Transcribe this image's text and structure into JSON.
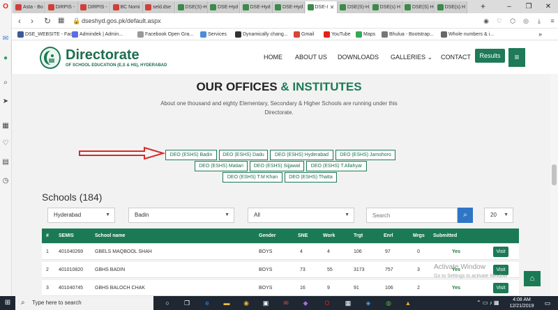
{
  "browser": {
    "tabs": [
      {
        "label": "Asta - Bo",
        "color": "#d0403a"
      },
      {
        "label": "DIRPIS - ",
        "color": "#d0403a"
      },
      {
        "label": "DIRPIS - ",
        "color": "#d0403a"
      },
      {
        "label": "BC Nomi",
        "color": "#d0403a"
      },
      {
        "label": "seld.dse",
        "color": "#d0403a"
      },
      {
        "label": "DSE(S)-H",
        "color": "#3c8a4c"
      },
      {
        "label": "DSE-Hyd",
        "color": "#3c8a4c"
      },
      {
        "label": "DSE-Hyd",
        "color": "#3c8a4c"
      },
      {
        "label": "DSE-Hyd",
        "color": "#3c8a4c"
      },
      {
        "label": "DSE-I",
        "color": "#3c8a4c",
        "active": true
      },
      {
        "label": "DSE(S)-H",
        "color": "#3c8a4c"
      },
      {
        "label": "DSE(s) H",
        "color": "#3c8a4c"
      },
      {
        "label": "DSE(S) H",
        "color": "#3c8a4c"
      },
      {
        "label": "DSE(s) H",
        "color": "#3c8a4c"
      }
    ],
    "new_tab": "+",
    "url": "dseshyd.gos.pk/default.aspx",
    "bookmarks": [
      {
        "label": "DSE_WEBSITE - Fac...",
        "color": "#3b5998"
      },
      {
        "label": "Admindek | Admin...",
        "color": "#5b6ee1"
      },
      {
        "label": "Facebook Open Gra...",
        "color": "#999999"
      },
      {
        "label": "Services",
        "color": "#4e8cd9"
      },
      {
        "label": "Dynamically chang...",
        "color": "#333333"
      },
      {
        "label": "Gmail",
        "color": "#d44638"
      },
      {
        "label": "YouTube",
        "color": "#e62117"
      },
      {
        "label": "Maps",
        "color": "#34a853"
      },
      {
        "label": "Bhulua - Bootstrap...",
        "color": "#777777"
      },
      {
        "label": "Whole numbers & i...",
        "color": "#666666"
      }
    ],
    "bookmarks_more": "»"
  },
  "site": {
    "brand_title": "Directorate",
    "brand_subtitle": "OF SCHOOL EDUCATION (E,S & HS), HYDERABAD",
    "nav": [
      "HOME",
      "ABOUT US",
      "DOWNLOADS",
      "GALLERIES ⌄",
      "CONTACT"
    ],
    "results_label": "Results",
    "menu_icon": "≡",
    "accent_color": "#1b7a56"
  },
  "offices": {
    "heading_main": "OUR OFFICES",
    "heading_accent": "& INSTITUTES",
    "intro": "About one thousand and eighty Elementary, Secondary & Higher Schools are running under this Directorate.",
    "deo_buttons": [
      "DEO (ESHS) Badin",
      "DEO (ESHS) Dadu",
      "DEO (ESHS) Hyderabad",
      "DEO (ESHS) Jamshoro",
      "DEO (ESHS) Matiari",
      "DEO (ESHS) Sijjawal",
      "DEO (ESHS) T.Allahyar",
      "DEO (ESHS) T.M Khan",
      "DEO (ESHS) Thatta"
    ]
  },
  "schools": {
    "title": "Schools",
    "count": "(184)",
    "filters": {
      "district": "Hyderabad",
      "taluka": "Badin",
      "type": "All",
      "page_size": "20"
    },
    "search_placeholder": "Search",
    "columns": [
      "#",
      "SEMIS",
      "School name",
      "Gender",
      "SNE",
      "Work",
      "Trgt",
      "Enrl",
      "Mrgs",
      "Submitted"
    ],
    "rows": [
      {
        "n": "1",
        "semis": "401040269",
        "name": "GBELS MAQBOOL SHAH",
        "gender": "BOYS",
        "sne": "4",
        "work": "4",
        "trgt": "106",
        "enrl": "97",
        "mrgs": "0",
        "submitted": "Yes"
      },
      {
        "n": "2",
        "semis": "401010820",
        "name": "GBHS BADIN",
        "gender": "BOYS",
        "sne": "73",
        "work": "55",
        "trgt": "3173",
        "enrl": "757",
        "mrgs": "3",
        "submitted": "Yes"
      },
      {
        "n": "3",
        "semis": "401040745",
        "name": "GBHS BALOCH CHAK",
        "gender": "BOYS",
        "sne": "16",
        "work": "9",
        "trgt": "91",
        "enrl": "106",
        "mrgs": "2",
        "submitted": "Yes"
      }
    ],
    "visit_label": "Visit"
  },
  "watermark": {
    "line1": "Activate Window",
    "line2": "Go to Settings to activate Window"
  },
  "taskbar": {
    "search_placeholder": "Type here to search",
    "time": "4:08 AM",
    "date": "12/21/2019"
  }
}
